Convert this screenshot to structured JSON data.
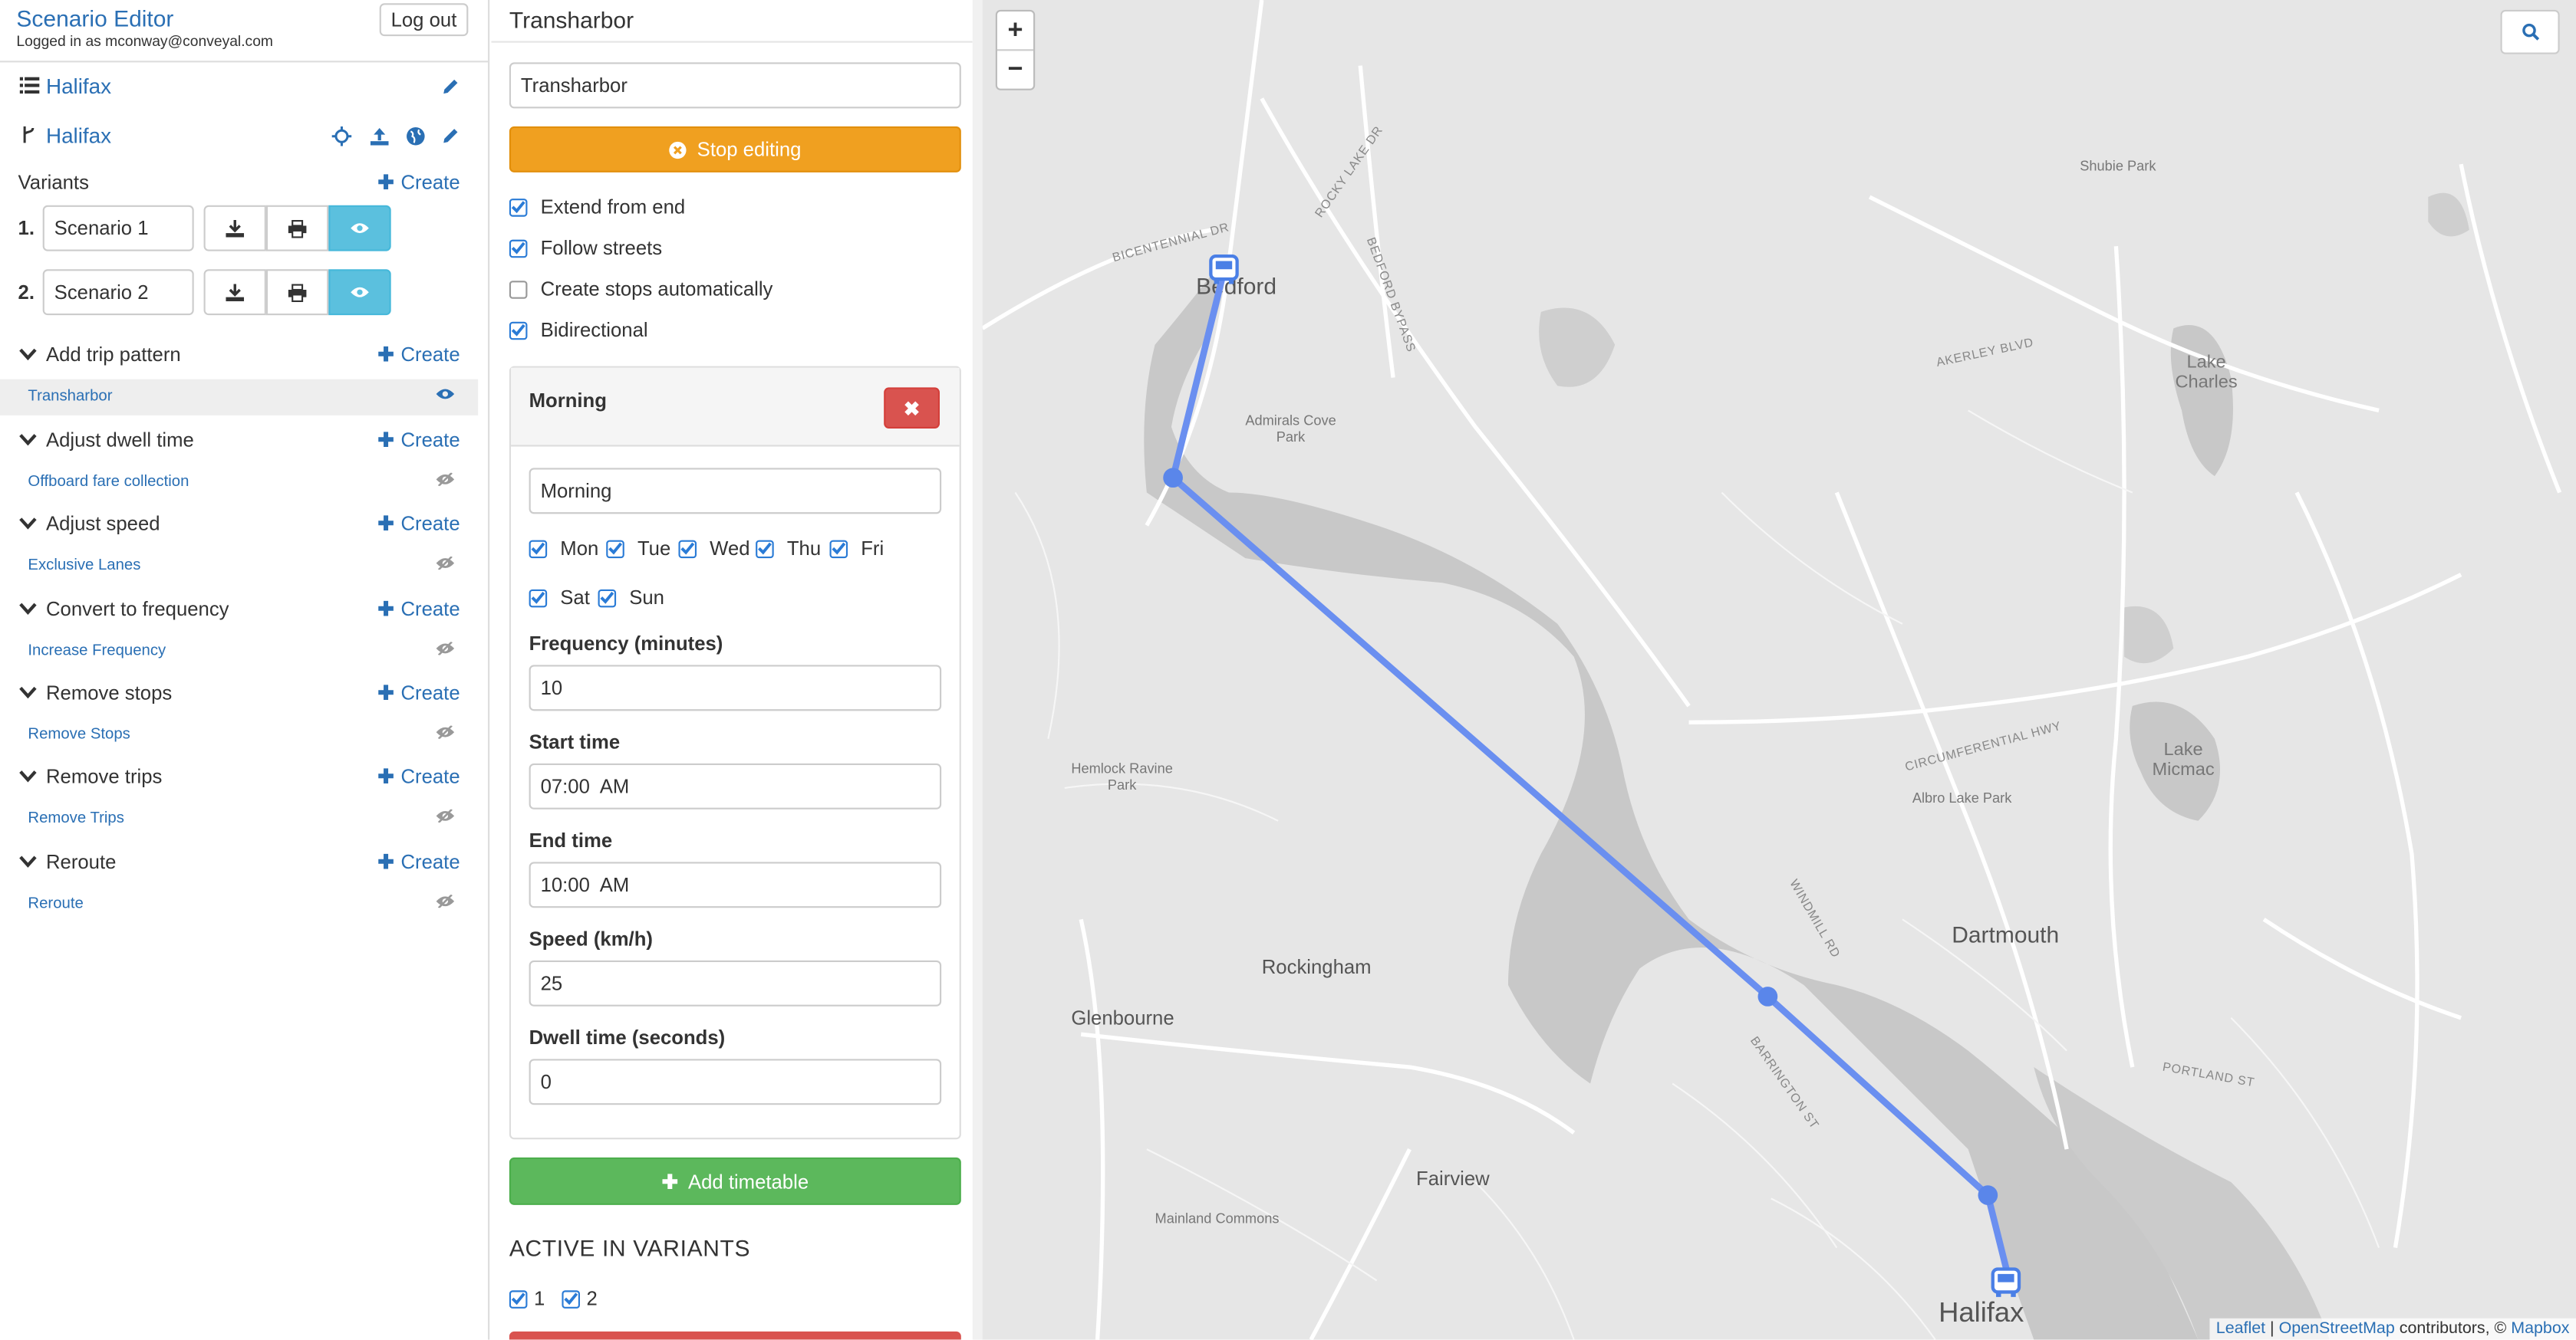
{
  "header": {
    "title": "Scenario Editor",
    "logged_in": "Logged in as mconway@conveyal.com",
    "logout_label": "Log out"
  },
  "project": {
    "region_name": "Halifax",
    "bundle_name": "Halifax"
  },
  "variants": {
    "label": "Variants",
    "create_label": "Create",
    "items": [
      {
        "num": "1.",
        "name": "Scenario 1"
      },
      {
        "num": "2.",
        "name": "Scenario 2"
      }
    ]
  },
  "modifications": [
    {
      "type": "Add trip pattern",
      "create": "Create",
      "items": [
        "Transharbor"
      ]
    },
    {
      "type": "Adjust dwell time",
      "create": "Create",
      "items": [
        "Offboard fare collection"
      ]
    },
    {
      "type": "Adjust speed",
      "create": "Create",
      "items": [
        "Exclusive Lanes"
      ]
    },
    {
      "type": "Convert to frequency",
      "create": "Create",
      "items": [
        "Increase Frequency"
      ]
    },
    {
      "type": "Remove stops",
      "create": "Create",
      "items": [
        "Remove Stops"
      ]
    },
    {
      "type": "Remove trips",
      "create": "Create",
      "items": [
        "Remove Trips"
      ]
    },
    {
      "type": "Reroute",
      "create": "Create",
      "items": [
        "Reroute"
      ]
    }
  ],
  "editor": {
    "title": "Transharbor",
    "name_value": "Transharbor",
    "stop_editing_label": "Stop editing",
    "options": [
      {
        "label": "Extend from end",
        "checked": true
      },
      {
        "label": "Follow streets",
        "checked": true
      },
      {
        "label": "Create stops automatically",
        "checked": false
      },
      {
        "label": "Bidirectional",
        "checked": true
      }
    ],
    "timetable": {
      "header": "Morning",
      "name_value": "Morning",
      "days": [
        {
          "label": "Mon",
          "checked": true
        },
        {
          "label": "Tue",
          "checked": true
        },
        {
          "label": "Wed",
          "checked": true
        },
        {
          "label": "Thu",
          "checked": true
        },
        {
          "label": "Fri",
          "checked": true
        },
        {
          "label": "Sat",
          "checked": true
        },
        {
          "label": "Sun",
          "checked": true
        }
      ],
      "frequency_label": "Frequency (minutes)",
      "frequency_value": "10",
      "start_label": "Start time",
      "start_value": "07:00  AM",
      "end_label": "End time",
      "end_value": "10:00  AM",
      "speed_label": "Speed (km/h)",
      "speed_value": "25",
      "dwell_label": "Dwell time (seconds)",
      "dwell_value": "0"
    },
    "add_timetable_label": "Add timetable",
    "active_title": "ACTIVE IN VARIANTS",
    "active_variants": [
      {
        "label": "1",
        "checked": true
      },
      {
        "label": "2",
        "checked": true
      }
    ]
  },
  "map": {
    "zoom_in": "+",
    "zoom_out": "−",
    "route_color": "#6a8ff0",
    "labels": {
      "bedford": "Bedford",
      "dartmouth": "Dartmouth",
      "halifax": "Halifax",
      "rockingham": "Rockingham",
      "glenbourne": "Glenbourne",
      "fairview": "Fairview",
      "lake_charles": "Lake\nCharles",
      "lake_micmac": "Lake\nMicmac",
      "shubie_park": "Shubie Park",
      "admirals_cove": "Admirals Cove\nPark",
      "hemlock_ravine": "Hemlock Ravine\nPark",
      "albro_lake": "Albro Lake Park",
      "mainland_commons": "Mainland Commons",
      "bicentennial": "BICENTENNIAL DR",
      "rocky_lake": "ROCKY LAKE DR",
      "bedford_bypass": "BEDFORD BYPASS",
      "akerley": "AKERLEY BLVD",
      "windmill": "WINDMILL RD",
      "circumferential": "CIRCUMFERENTIAL HWY",
      "barrington": "BARRINGTON ST",
      "portland": "PORTLAND ST"
    },
    "attribution": {
      "leaflet": "Leaflet",
      "osm": "OpenStreetMap",
      "rest": " contributors, © ",
      "mapbox": "Mapbox"
    }
  }
}
